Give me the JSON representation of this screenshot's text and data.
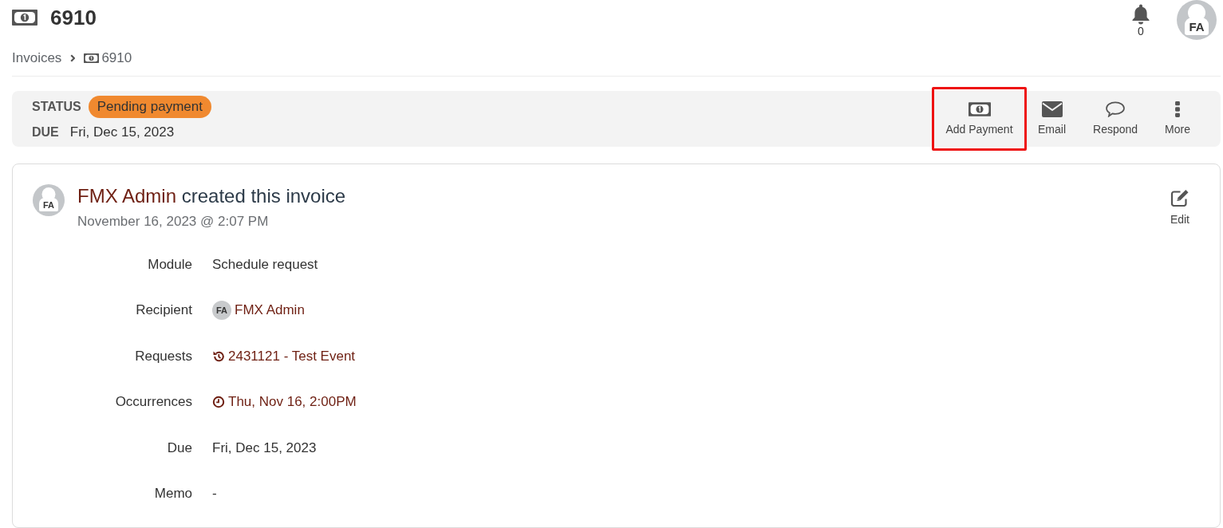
{
  "header": {
    "title": "6910",
    "notification_count": "0",
    "avatar_initials": "FA"
  },
  "breadcrumb": [
    {
      "label": "Invoices",
      "kind": "link"
    },
    {
      "label": "6910",
      "kind": "invoice"
    }
  ],
  "status_bar": {
    "status_label": "STATUS",
    "status": "Pending payment",
    "due_label": "DUE",
    "due": "Fri, Dec 15, 2023",
    "actions": [
      {
        "label": "Add Payment",
        "kind": "payment",
        "highlighted": true
      },
      {
        "label": "Email",
        "kind": "email",
        "highlighted": false
      },
      {
        "label": "Respond",
        "kind": "respond",
        "highlighted": false
      },
      {
        "label": "More",
        "kind": "more",
        "highlighted": false
      }
    ]
  },
  "activity": {
    "avatar_initials": "FA",
    "author": "FMX Admin",
    "action_text": "created this invoice",
    "timestamp": "November 16, 2023 @ 2:07 PM",
    "edit_label": "Edit",
    "fields": [
      {
        "label": "Module",
        "value": "Schedule request",
        "kind": "text"
      },
      {
        "label": "Recipient",
        "value": "FMX Admin",
        "kind": "person",
        "initials": "FA"
      },
      {
        "label": "Requests",
        "value": "2431121 - Test Event",
        "kind": "request"
      },
      {
        "label": "Occurrences",
        "value": "Thu, Nov 16, 2:00PM",
        "kind": "occurrence"
      },
      {
        "label": "Due",
        "value": "Fri, Dec 15, 2023",
        "kind": "text"
      },
      {
        "label": "Memo",
        "value": "-",
        "kind": "text"
      }
    ]
  }
}
